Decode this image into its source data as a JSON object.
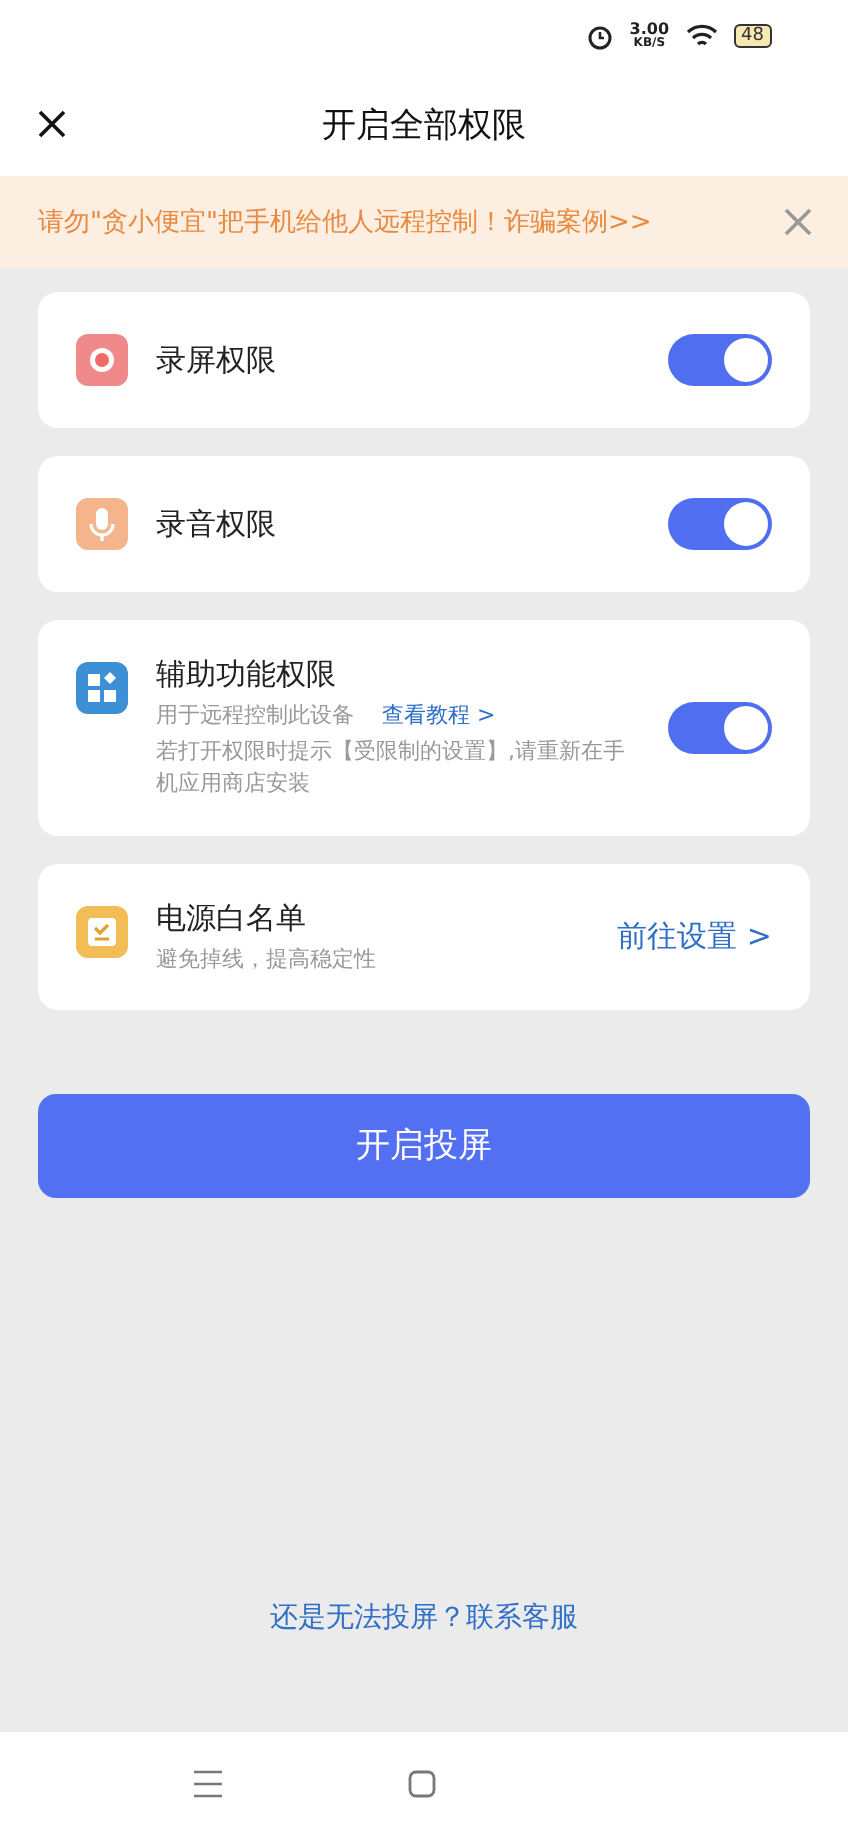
{
  "status_bar": {
    "speed": "3.00",
    "speed_unit": "KB/S",
    "battery": "48"
  },
  "header": {
    "title": "开启全部权限"
  },
  "notice": {
    "text": "请勿\"贪小便宜\"把手机给他人远程控制！诈骗案例>>"
  },
  "permissions": [
    {
      "kind": "toggle",
      "title": "录屏权限",
      "on": true
    },
    {
      "kind": "toggle",
      "title": "录音权限",
      "on": true
    },
    {
      "kind": "toggle",
      "title": "辅助功能权限",
      "subtitle": "用于远程控制此设备",
      "link": "查看教程 >",
      "note": "若打开权限时提示【受限制的设置】,请重新在手机应用商店安装",
      "on": true
    },
    {
      "kind": "link",
      "title": "电源白名单",
      "subtitle": "避免掉线，提高稳定性",
      "action": "前往设置 >"
    }
  ],
  "primary_button": "开启投屏",
  "help_link": "还是无法投屏？联系客服"
}
